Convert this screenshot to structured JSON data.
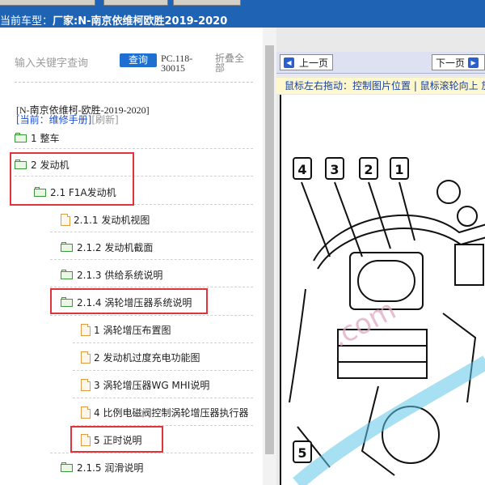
{
  "header": {
    "car_model_label": "当前车型：",
    "car_model_value": "厂家:N-南京依维柯欧胜2019-2020"
  },
  "sidebar": {
    "search_placeholder": "输入关键字查询",
    "search_button": "查询",
    "code": "PC.118-30015",
    "fold_all": "折叠全部",
    "car_title": "[N-南京依维柯-欧胜-2019-2020]",
    "current_label": "[当前：维修手册]",
    "refresh": "[刷新]",
    "tree": [
      {
        "label": "1 整车",
        "icon": "folder-icon"
      },
      {
        "label": "2 发动机",
        "icon": "folder-open-icon"
      },
      {
        "label": "2.1 F1A发动机",
        "icon": "folder-open-icon"
      },
      {
        "label": "2.1.1 发动机视图",
        "icon": "document-icon"
      },
      {
        "label": "2.1.2 发动机截面",
        "icon": "folder-icon"
      },
      {
        "label": "2.1.3 供给系统说明",
        "icon": "folder-icon"
      },
      {
        "label": "2.1.4 涡轮增压器系统说明",
        "icon": "folder-open-icon"
      },
      {
        "label": "1 涡轮增压布置图",
        "icon": "document-icon"
      },
      {
        "label": "2 发动机过度充电功能图",
        "icon": "document-icon"
      },
      {
        "label": "3 涡轮增压器WG MHI说明",
        "icon": "document-icon"
      },
      {
        "label": "4 比例电磁阀控制涡轮增压器执行器",
        "icon": "document-icon"
      },
      {
        "label": "5 正时说明",
        "icon": "document-icon"
      },
      {
        "label": "2.1.5 润滑说明",
        "icon": "folder-icon"
      }
    ]
  },
  "viewer": {
    "prev_page": "上一页",
    "next_page": "下一页",
    "hint": "鼠标左右拖动：控制图片位置 | 鼠标滚轮向上 放",
    "diagram_callouts": [
      "4",
      "3",
      "2",
      "1",
      "5"
    ],
    "watermark": ".com"
  },
  "colors": {
    "highlight": "#e2333a",
    "accent": "#1f6fd0",
    "header_bg": "#1f64b4"
  }
}
